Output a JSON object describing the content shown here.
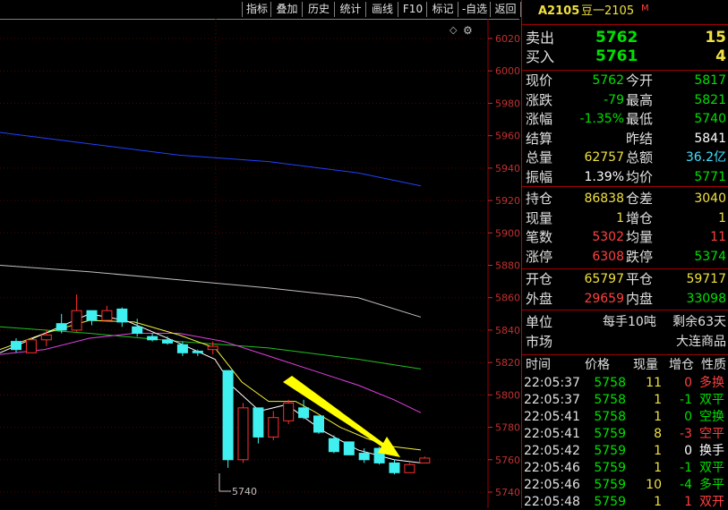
{
  "toolbar": {
    "buttons": [
      "指标",
      "叠加",
      "历史",
      "统计",
      "画线",
      "F10",
      "标记",
      "-自选",
      "返回"
    ]
  },
  "chart": {
    "price_ticks": [
      "6020",
      "6000",
      "5980",
      "5960",
      "5940",
      "5920",
      "5900",
      "5880",
      "5860",
      "5840",
      "5820",
      "5800",
      "5780",
      "5760",
      "5740"
    ],
    "low_marker": "5740",
    "corner_icons": [
      "diamond-icon",
      "settings-icon"
    ]
  },
  "chart_data": {
    "type": "candlestick",
    "ylim": [
      5735,
      6025
    ],
    "candles": [
      {
        "o": 5833,
        "h": 5835,
        "l": 5826,
        "c": 5828,
        "dir": "down"
      },
      {
        "o": 5826,
        "h": 5835,
        "l": 5826,
        "c": 5834,
        "dir": "up"
      },
      {
        "o": 5834,
        "h": 5840,
        "l": 5830,
        "c": 5837,
        "dir": "up"
      },
      {
        "o": 5844,
        "h": 5850,
        "l": 5838,
        "c": 5840,
        "dir": "down"
      },
      {
        "o": 5840,
        "h": 5862,
        "l": 5839,
        "c": 5852,
        "dir": "up"
      },
      {
        "o": 5852,
        "h": 5852,
        "l": 5843,
        "c": 5846,
        "dir": "down"
      },
      {
        "o": 5846,
        "h": 5855,
        "l": 5846,
        "c": 5852,
        "dir": "up"
      },
      {
        "o": 5853,
        "h": 5854,
        "l": 5842,
        "c": 5845,
        "dir": "down"
      },
      {
        "o": 5842,
        "h": 5847,
        "l": 5836,
        "c": 5838,
        "dir": "down"
      },
      {
        "o": 5836,
        "h": 5838,
        "l": 5833,
        "c": 5834,
        "dir": "down"
      },
      {
        "o": 5834,
        "h": 5836,
        "l": 5831,
        "c": 5832,
        "dir": "down"
      },
      {
        "o": 5831,
        "h": 5833,
        "l": 5824,
        "c": 5826,
        "dir": "down"
      },
      {
        "o": 5827,
        "h": 5828,
        "l": 5824,
        "c": 5826,
        "dir": "down"
      },
      {
        "o": 5828,
        "h": 5833,
        "l": 5825,
        "c": 5830,
        "dir": "up"
      },
      {
        "o": 5815,
        "h": 5815,
        "l": 5755,
        "c": 5760,
        "dir": "down"
      },
      {
        "o": 5760,
        "h": 5795,
        "l": 5758,
        "c": 5792,
        "dir": "up"
      },
      {
        "o": 5792,
        "h": 5792,
        "l": 5770,
        "c": 5774,
        "dir": "down"
      },
      {
        "o": 5774,
        "h": 5790,
        "l": 5772,
        "c": 5786,
        "dir": "up"
      },
      {
        "o": 5784,
        "h": 5797,
        "l": 5782,
        "c": 5795,
        "dir": "up"
      },
      {
        "o": 5792,
        "h": 5797,
        "l": 5785,
        "c": 5786,
        "dir": "down"
      },
      {
        "o": 5787,
        "h": 5787,
        "l": 5776,
        "c": 5777,
        "dir": "down"
      },
      {
        "o": 5773,
        "h": 5775,
        "l": 5764,
        "c": 5765,
        "dir": "down"
      },
      {
        "o": 5771,
        "h": 5771,
        "l": 5763,
        "c": 5763,
        "dir": "down"
      },
      {
        "o": 5764,
        "h": 5767,
        "l": 5758,
        "c": 5760,
        "dir": "down"
      },
      {
        "o": 5767,
        "h": 5768,
        "l": 5757,
        "c": 5758,
        "dir": "down"
      },
      {
        "o": 5758,
        "h": 5760,
        "l": 5751,
        "c": 5752,
        "dir": "down"
      },
      {
        "o": 5752,
        "h": 5758,
        "l": 5752,
        "c": 5757,
        "dir": "up"
      },
      {
        "o": 5758,
        "h": 5762,
        "l": 5758,
        "c": 5761,
        "dir": "up"
      }
    ],
    "lines": [
      {
        "color": "#2040ff",
        "points": [
          [
            0,
            5962
          ],
          [
            100,
            5955
          ],
          [
            200,
            5948
          ],
          [
            300,
            5944
          ],
          [
            400,
            5937
          ],
          [
            470,
            5929
          ]
        ]
      },
      {
        "color": "#c0c0c0",
        "points": [
          [
            0,
            5880
          ],
          [
            100,
            5876
          ],
          [
            200,
            5871
          ],
          [
            300,
            5866
          ],
          [
            400,
            5860
          ],
          [
            470,
            5848
          ]
        ]
      },
      {
        "color": "#20c020",
        "points": [
          [
            0,
            5842
          ],
          [
            100,
            5838
          ],
          [
            200,
            5833
          ],
          [
            300,
            5829
          ],
          [
            400,
            5822
          ],
          [
            470,
            5816
          ]
        ]
      },
      {
        "color": "#e040e0",
        "points": [
          [
            0,
            5825
          ],
          [
            50,
            5828
          ],
          [
            100,
            5835
          ],
          [
            150,
            5838
          ],
          [
            200,
            5838
          ],
          [
            250,
            5833
          ],
          [
            300,
            5824
          ],
          [
            350,
            5815
          ],
          [
            400,
            5806
          ],
          [
            440,
            5797
          ],
          [
            470,
            5789
          ]
        ]
      },
      {
        "color": "#f0f040",
        "points": [
          [
            0,
            5828
          ],
          [
            50,
            5838
          ],
          [
            100,
            5846
          ],
          [
            150,
            5845
          ],
          [
            200,
            5837
          ],
          [
            240,
            5829
          ],
          [
            270,
            5808
          ],
          [
            300,
            5796
          ],
          [
            330,
            5796
          ],
          [
            350,
            5790
          ],
          [
            380,
            5780
          ],
          [
            410,
            5773
          ],
          [
            440,
            5768
          ],
          [
            470,
            5766
          ]
        ]
      },
      {
        "color": "#ffffff",
        "points": [
          [
            0,
            5826
          ],
          [
            50,
            5838
          ],
          [
            100,
            5850
          ],
          [
            140,
            5846
          ],
          [
            200,
            5832
          ],
          [
            240,
            5822
          ],
          [
            260,
            5805
          ],
          [
            290,
            5790
          ],
          [
            320,
            5794
          ],
          [
            360,
            5778
          ],
          [
            400,
            5766
          ],
          [
            440,
            5760
          ],
          [
            470,
            5758
          ]
        ]
      }
    ]
  },
  "quote": {
    "code": "A2105",
    "name": "豆一2105",
    "flag": "M",
    "sell_label": "卖出",
    "sell_price": "5762",
    "sell_vol": "15",
    "buy_label": "买入",
    "buy_price": "5761",
    "buy_vol": "4",
    "rows": [
      {
        "l1": "现价",
        "v1": "5762",
        "c1": "grn",
        "l2": "今开",
        "v2": "5817",
        "c2": "grn"
      },
      {
        "l1": "涨跌",
        "v1": "-79",
        "c1": "grn",
        "l2": "最高",
        "v2": "5821",
        "c2": "grn"
      },
      {
        "l1": "涨幅",
        "v1": "-1.35%",
        "c1": "grn",
        "l2": "最低",
        "v2": "5740",
        "c2": "grn"
      },
      {
        "l1": "结算",
        "v1": "",
        "c1": "grn",
        "l2": "昨结",
        "v2": "5841",
        "c2": "wht"
      },
      {
        "l1": "总量",
        "v1": "62757",
        "c1": "yel",
        "l2": "总额",
        "v2": "36.2亿",
        "c2": "cyan"
      },
      {
        "l1": "振幅",
        "v1": "1.39%",
        "c1": "wht",
        "l2": "均价",
        "v2": "5771",
        "c2": "grn"
      }
    ],
    "rows2": [
      {
        "l1": "持仓",
        "v1": "86838",
        "c1": "yel",
        "l2": "仓差",
        "v2": "3040",
        "c2": "yel"
      },
      {
        "l1": "现量",
        "v1": "1",
        "c1": "yel",
        "l2": "增仓",
        "v2": "1",
        "c2": "yel"
      },
      {
        "l1": "笔数",
        "v1": "5302",
        "c1": "red",
        "l2": "均量",
        "v2": "11",
        "c2": "red"
      },
      {
        "l1": "涨停",
        "v1": "6308",
        "c1": "red",
        "l2": "跌停",
        "v2": "5374",
        "c2": "grn"
      }
    ],
    "rows3": [
      {
        "l1": "开仓",
        "v1": "65797",
        "c1": "yel",
        "l2": "平仓",
        "v2": "59717",
        "c2": "yel"
      },
      {
        "l1": "外盘",
        "v1": "29659",
        "c1": "red",
        "l2": "内盘",
        "v2": "33098",
        "c2": "grn"
      }
    ],
    "unit_label": "单位",
    "unit_value": "每手10吨",
    "remain": "剩余63天",
    "market_label": "市场",
    "market_value": "大连商品"
  },
  "ticks": {
    "headers": [
      "时间",
      "价格",
      "现量",
      "增仓",
      "性质"
    ],
    "rows": [
      {
        "t": "22:05:37",
        "p": "5758",
        "q": "11",
        "d": "0",
        "n": "多换",
        "qc": "yel",
        "dc": "red",
        "nc": "red"
      },
      {
        "t": "22:05:37",
        "p": "5758",
        "q": "1",
        "d": "-1",
        "n": "双平",
        "qc": "yel",
        "dc": "grn",
        "nc": "grn"
      },
      {
        "t": "22:05:41",
        "p": "5758",
        "q": "1",
        "d": "0",
        "n": "空换",
        "qc": "yel",
        "dc": "grn",
        "nc": "grn"
      },
      {
        "t": "22:05:41",
        "p": "5759",
        "q": "8",
        "d": "-3",
        "n": "空平",
        "qc": "yel",
        "dc": "red",
        "nc": "red"
      },
      {
        "t": "22:05:42",
        "p": "5759",
        "q": "1",
        "d": "0",
        "n": "换手",
        "qc": "yel",
        "dc": "wht",
        "nc": "wht"
      },
      {
        "t": "22:05:46",
        "p": "5759",
        "q": "1",
        "d": "-1",
        "n": "双平",
        "qc": "yel",
        "dc": "grn",
        "nc": "grn"
      },
      {
        "t": "22:05:46",
        "p": "5759",
        "q": "10",
        "d": "-4",
        "n": "多平",
        "qc": "yel",
        "dc": "grn",
        "nc": "grn"
      },
      {
        "t": "22:05:48",
        "p": "5759",
        "q": "1",
        "d": "1",
        "n": "双开",
        "qc": "yel",
        "dc": "red",
        "nc": "red"
      }
    ]
  },
  "colors": {
    "up": "#ff3030",
    "down": "#40f0f0",
    "axis": "#c03030",
    "grid": "#4a0000"
  }
}
